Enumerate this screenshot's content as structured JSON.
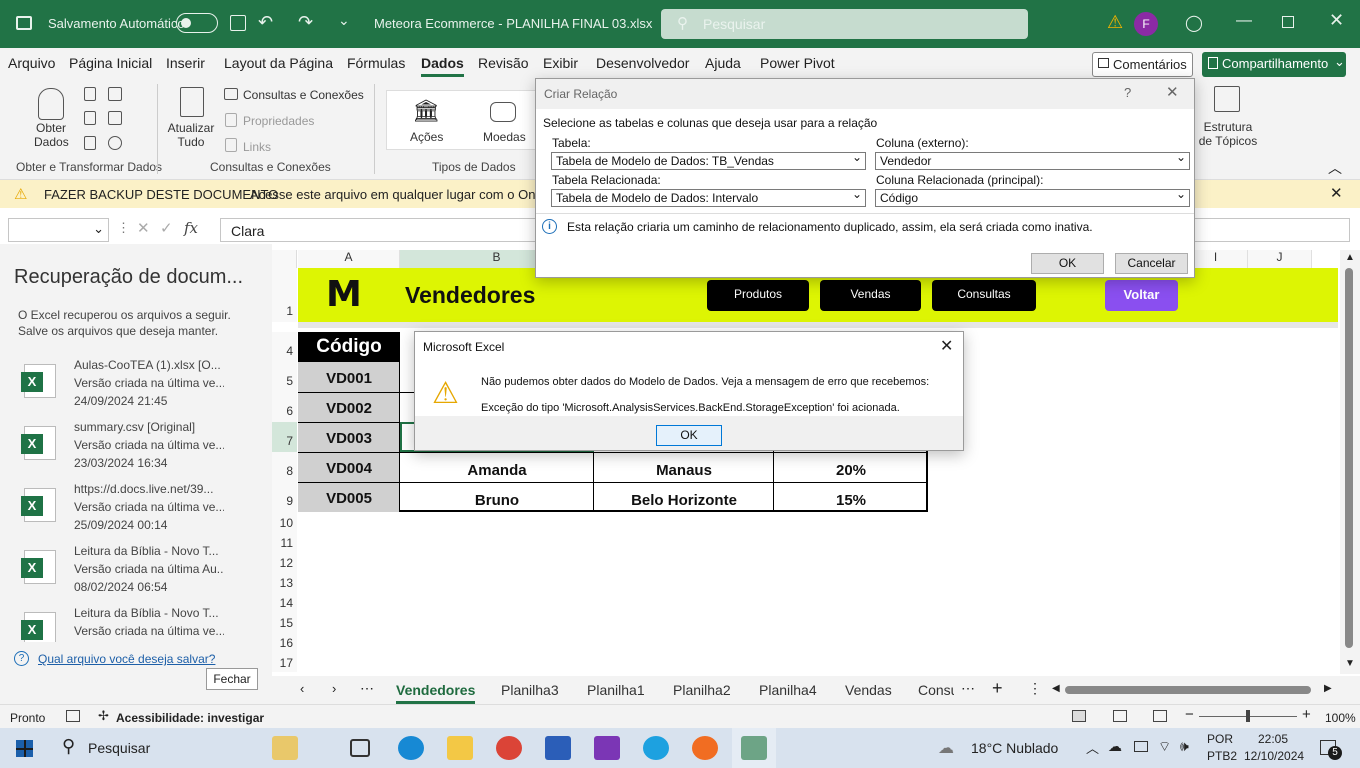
{
  "titlebar": {
    "autosave_label": "Salvamento Automático",
    "document_title": "Meteora Ecommerce - PLANILHA FINAL 03.xlsx",
    "search_placeholder": "Pesquisar",
    "avatar_letter": "F"
  },
  "menu": {
    "items": [
      "Arquivo",
      "Página Inicial",
      "Inserir",
      "Layout da Página",
      "Fórmulas",
      "Dados",
      "Revisão",
      "Exibir",
      "Desenvolvedor",
      "Ajuda",
      "Power Pivot"
    ],
    "active": "Dados",
    "comments_label": "Comentários",
    "share_label": "Compartilhamento"
  },
  "ribbon": {
    "get_data_label": "Obter Dados",
    "refresh_all_label": "Atualizar Tudo",
    "queries_connections": "Consultas e Conexões",
    "properties": "Propriedades",
    "links": "Links",
    "actions": "Ações",
    "currencies": "Moedas",
    "outline": "Estrutura de Tópicos",
    "group_get_transform": "Obter e Transformar Dados",
    "group_queries": "Consultas e Conexões",
    "group_data_types": "Tipos de Dados"
  },
  "message_bar": {
    "title": "FAZER BACKUP DESTE DOCUMENTO",
    "text": "Acesse este arquivo em qualquer lugar com o OneDriv"
  },
  "formula_bar": {
    "fx_label": "fx",
    "value": "Clara"
  },
  "recovery": {
    "title": "Recuperação de docum...",
    "description_1": "O Excel recuperou os arquivos a seguir.",
    "description_2": "Salve os arquivos que deseja manter.",
    "files": [
      {
        "name": "Aulas-CooTEA (1).xlsx  [O...",
        "status": "Versão criada na última ve...",
        "date": "24/09/2024 21:45",
        "icon": "excel-file-icon"
      },
      {
        "name": "summary.csv  [Original]",
        "status": "Versão criada na última ve...",
        "date": "23/03/2024 16:34",
        "icon": "csv-file-icon"
      },
      {
        "name": "https://d.docs.live.net/39...",
        "status": "Versão criada na última ve...",
        "date": "25/09/2024 00:14",
        "icon": "excel-file-icon"
      },
      {
        "name": "Leitura da Bíblia - Novo T...",
        "status": "Versão criada na última Au...",
        "date": "08/02/2024 06:54",
        "icon": "excel-file-icon"
      },
      {
        "name": "Leitura da Bíblia - Novo T...",
        "status": "Versão criada na última ve...",
        "date": "",
        "icon": "excel-file-icon"
      }
    ],
    "help_link": "Qual arquivo você deseja salvar?",
    "close_button": "Fechar"
  },
  "sheet": {
    "columns": [
      "A",
      "B",
      "I",
      "J"
    ],
    "rows": [
      "1",
      "4",
      "5",
      "6",
      "7",
      "8",
      "9",
      "10",
      "11",
      "12",
      "13",
      "14",
      "15",
      "16",
      "17"
    ],
    "banner": {
      "logo": "M",
      "title": "Vendedores",
      "nav_buttons": [
        "Produtos",
        "Vendas",
        "Consultas"
      ],
      "back_button": "Voltar"
    },
    "table_header": "Código",
    "data_rows": [
      {
        "code": "VD001",
        "name": "",
        "city": "",
        "pct": ""
      },
      {
        "code": "VD002",
        "name": "",
        "city": "",
        "pct": ""
      },
      {
        "code": "VD003",
        "name": "",
        "city": "",
        "pct": ""
      },
      {
        "code": "VD004",
        "name": "Amanda",
        "city": "Manaus",
        "pct": "20%"
      },
      {
        "code": "VD005",
        "name": "Bruno",
        "city": "Belo Horizonte",
        "pct": "15%"
      }
    ]
  },
  "sheet_tabs": {
    "items": [
      "Vendedores",
      "Planilha3",
      "Planilha1",
      "Planilha2",
      "Planilha4",
      "Vendas",
      "Consu"
    ],
    "active": "Vendedores"
  },
  "statusbar": {
    "ready": "Pronto",
    "accessibility": "Acessibilidade: investigar",
    "zoom": "100%"
  },
  "taskbar": {
    "search_label": "Pesquisar",
    "weather": "18°C  Nublado",
    "lang_1": "POR",
    "lang_2": "PTB2",
    "time": "22:05",
    "date": "12/10/2024",
    "notifications": "5"
  },
  "dialog_relation": {
    "title": "Criar Relação",
    "help": "?",
    "instruction": "Selecione as tabelas e colunas que deseja usar para a relação",
    "table_label": "Tabela:",
    "table_value": "Tabela de Modelo de Dados: TB_Vendas",
    "column_label": "Coluna (externo):",
    "column_value": "Vendedor",
    "related_table_label": "Tabela Relacionada:",
    "related_table_value": "Tabela de Modelo de Dados: Intervalo",
    "related_column_label": "Coluna Relacionada (principal):",
    "related_column_value": "Código",
    "info": "Esta relação criaria um caminho de relacionamento duplicado, assim, ela será criada como inativa.",
    "ok": "OK",
    "cancel": "Cancelar"
  },
  "dialog_error": {
    "title": "Microsoft Excel",
    "line_1": "Não pudemos obter dados do Modelo de Dados. Veja a mensagem de erro que recebemos:",
    "line_2": "Exceção do tipo 'Microsoft.AnalysisServices.BackEnd.StorageException' foi acionada.",
    "ok": "OK"
  },
  "colors": {
    "excel_green": "#217346",
    "banner_yellow": "#ddf503",
    "button_black": "#000000",
    "back_button": "#8a4ff0",
    "warning": "#e6a700"
  }
}
